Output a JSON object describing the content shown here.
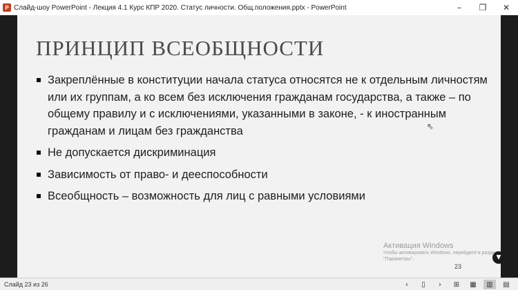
{
  "window": {
    "title": "Слайд-шоу PowerPoint  -  Лекция 4.1 Курс КПР 2020. Статус личности. Общ.положения.pptx  -  PowerPoint",
    "app_icon_letter": "P",
    "controls": {
      "minimize": "–",
      "restore": "❐",
      "close": "✕"
    }
  },
  "slide": {
    "title": "ПРИНЦИП ВСЕОБЩНОСТИ",
    "bullets": [
      "Закреплённые в конституции начала статуса относятся не к отдельным личностям или их группам, а ко всем без исключения гражданам государства, а также – по общему правилу и с исключениями, указанными в законе, - к иностранным гражданам и лицам без гражданства",
      "Не допускается дискриминация",
      "Зависимость от право- и дееспособности",
      "Всеобщность – возможность для лиц с равными условиями"
    ],
    "slide_number": "23"
  },
  "watermark": {
    "title": "Активация Windows",
    "line1": "Чтобы активировать Windows, перейдите в раздел",
    "line2": "\"Параметры\"."
  },
  "statusbar": {
    "slide_counter": "Слайд 23 из 26",
    "icons": [
      "chevron-left-icon",
      "pen-icon",
      "chevron-right-icon",
      "grid-icon",
      "slide-sorter-icon",
      "reading-view-icon",
      "slideshow-icon"
    ]
  }
}
